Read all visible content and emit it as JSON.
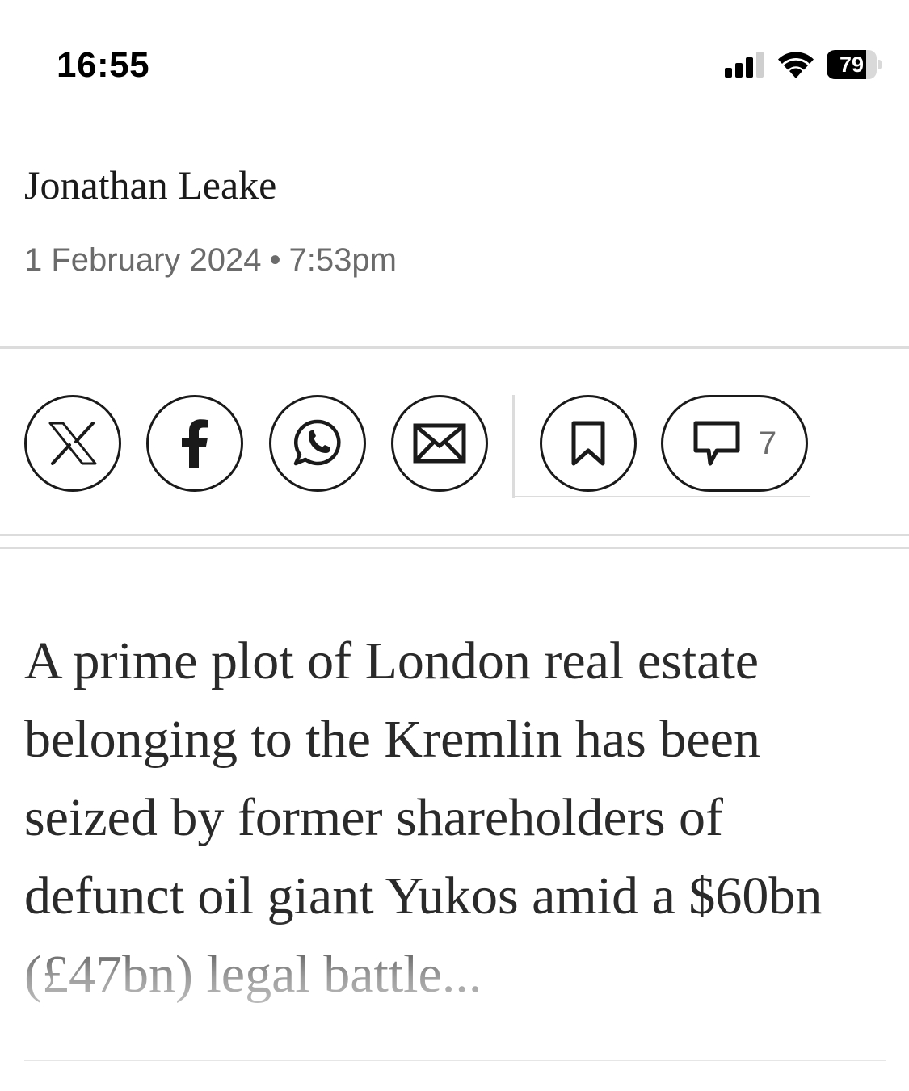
{
  "status_bar": {
    "time": "16:55",
    "battery_level": "79",
    "battery_fraction": 0.79,
    "icons": [
      "cellular-signal-icon",
      "wifi-icon",
      "battery-icon"
    ]
  },
  "article": {
    "author": "Jonathan Leake",
    "date": "1 February 2024",
    "date_separator": "•",
    "time": "7:53pm",
    "standfirst": "A prime plot of London real estate belonging to the Kremlin has been seized by former shareholders of defunct oil giant Yukos amid a $60bn (£47bn) legal battle..."
  },
  "share_bar": {
    "buttons": [
      "x-share-button",
      "facebook-share-button",
      "whatsapp-share-button",
      "email-share-button",
      "bookmark-button",
      "comments-button"
    ],
    "comment_count": "7"
  },
  "colors": {
    "text": "#1a1a1a",
    "muted": "#6b6b6b",
    "rule": "#dcdcdc",
    "background": "#ffffff"
  }
}
